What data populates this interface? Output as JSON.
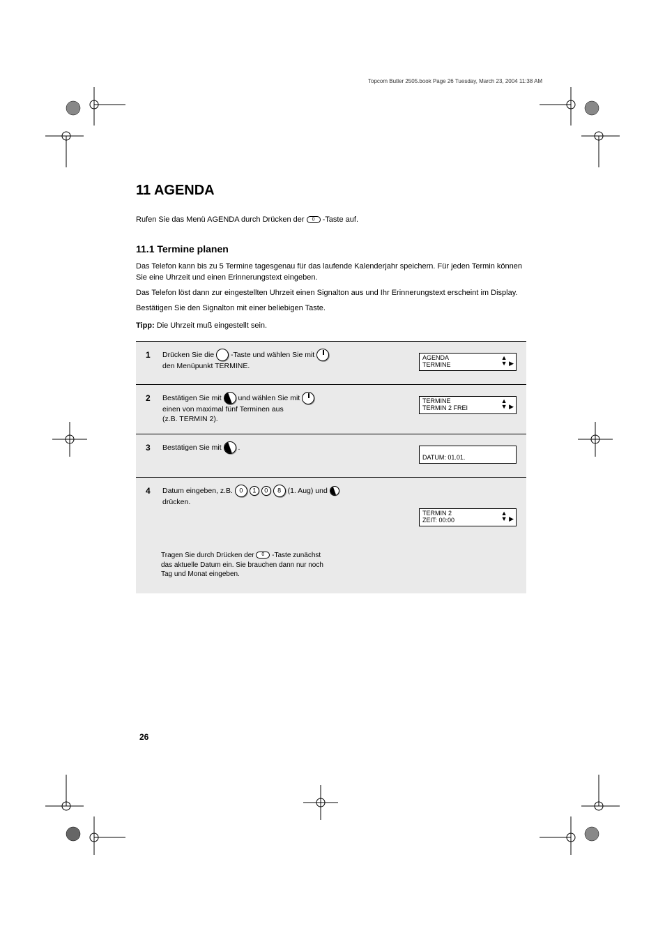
{
  "book_ref": "Topcom Butler 2505.book Page 26 Tuesday, March 23, 2004 11:38 AM",
  "page": {
    "title": "11 AGENDA",
    "intro_prefix": "Rufen Sie das Menü AGENDA durch Drücken der",
    "intro_suffix": "-Taste auf.",
    "section_heading": "11.1 Termine planen",
    "body1": "Das Telefon kann bis zu 5 Termine tagesgenau für das laufende Kalenderjahr speichern. Für jeden Termin können Sie eine Uhrzeit und einen Erinnerungstext eingeben.",
    "body2": "Das Telefon löst dann zur eingestellten Uhrzeit einen Signalton aus und Ihr Erinnerungstext erscheint im Display.",
    "body3": "Bestätigen Sie den Signalton mit einer beliebigen Taste.",
    "tip_label": "Tipp:",
    "tip_text": "Die Uhrzeit muß eingestellt sein.",
    "rows": [
      {
        "num": "1",
        "text_before": "Drücken Sie die",
        "text_mid1": "-Taste und wählen Sie mit",
        "text_mid2": "den Menüpunkt TERMINE.",
        "display_line1": "AGENDA",
        "display_line2": "TERMINE"
      },
      {
        "num": "2",
        "text_before": "Bestätigen Sie mit",
        "text_mid1": "und wählen Sie mit",
        "text_mid2": "einen von maximal fünf Terminen aus",
        "text_after": "(z.B. TERMIN 2).",
        "display_line1": "TERMINE",
        "display_line2": "TERMIN 2 FREI"
      },
      {
        "num": "3",
        "text_before": "Bestätigen Sie mit",
        "text_after": ".",
        "display_line2": "DATUM: 01.01."
      },
      {
        "num": "4",
        "text_line1": "Datum eingeben, z.B.",
        "text_seq": "(1. Aug) und",
        "text_line2_before": "drücken.",
        "display_line1": "TERMIN 2",
        "display_line2": "ZEIT: 00:00"
      }
    ],
    "footer_prefix": "Tragen Sie durch Drücken der",
    "footer_mid": "-Taste zunächst",
    "footer_line2": "das aktuelle Datum ein. Sie brauchen dann nur noch",
    "footer_line3": "Tag und Monat eingeben."
  },
  "page_number": "26"
}
